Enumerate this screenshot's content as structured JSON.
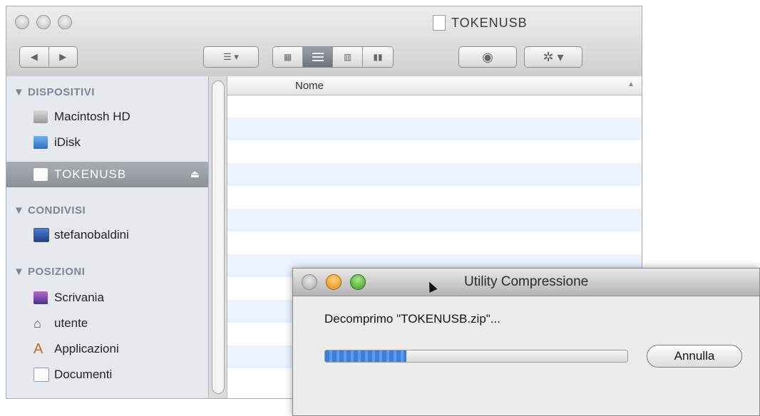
{
  "finder": {
    "window_title": "TOKENUSB",
    "sidebar": {
      "devices_header": "▼ DISPOSITIVI",
      "devices": [
        {
          "label": "Macintosh HD",
          "icon": "hard-drive-icon"
        },
        {
          "label": "iDisk",
          "icon": "idisk-icon"
        },
        {
          "label": "TOKENUSB",
          "icon": "usb-drive-icon",
          "selected": true
        }
      ],
      "shared_header": "▼ CONDIVISI",
      "shared": [
        {
          "label": "stefanobaldini",
          "icon": "computer-icon"
        }
      ],
      "places_header": "▼ POSIZIONI",
      "places": [
        {
          "label": "Scrivania",
          "icon": "desktop-icon"
        },
        {
          "label": "utente",
          "icon": "home-icon"
        },
        {
          "label": "Applicazioni",
          "icon": "applications-icon"
        },
        {
          "label": "Documenti",
          "icon": "documents-icon"
        }
      ]
    },
    "list": {
      "column_name": "Nome",
      "sort_indicator": "▲"
    },
    "colors": {
      "selected_sidebar": "#8b9197",
      "alt_row": "#edf3fe",
      "section_header": "#7b8794"
    }
  },
  "dialog": {
    "title": "Utility Compressione",
    "message": "Decomprimo \"TOKENUSB.zip\"...",
    "progress_fraction": 0.27,
    "cancel_label": "Annulla"
  }
}
